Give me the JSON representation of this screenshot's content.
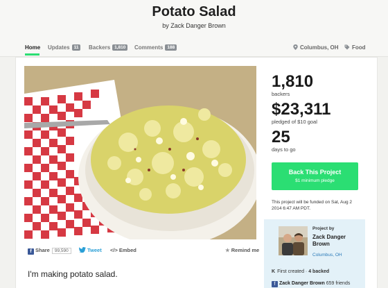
{
  "project": {
    "title": "Potato Salad",
    "byline": "by Zack Danger Brown",
    "description": "I'm making potato salad."
  },
  "nav": {
    "tabs": [
      {
        "label": "Home"
      },
      {
        "label": "Updates",
        "count": "11"
      },
      {
        "label": "Backers",
        "count": "1,810"
      },
      {
        "label": "Comments",
        "count": "188"
      }
    ],
    "location": "Columbus, OH",
    "category": "Food"
  },
  "share": {
    "facebook": "Share",
    "facebook_count": "99,590",
    "tweet": "Tweet",
    "embed": "Embed",
    "remind": "Remind me"
  },
  "stats": {
    "backers": "1,810",
    "backers_label": "backers",
    "pledged": "$23,311",
    "pledged_label": "pledged of $10 goal",
    "days": "25",
    "days_label": "days to go"
  },
  "cta": {
    "title": "Back This Project",
    "subtitle": "$1 minimum pledge"
  },
  "funding_note": "This project will be funded on Sat, Aug 2 2014 6:47 AM PDT.",
  "creator": {
    "label": "Project by",
    "name": "Zack Danger Brown",
    "location": "Columbus, OH",
    "created": "First created",
    "backed": "4 backed",
    "fb_name": "Zack Danger Brown",
    "fb_friends": "659 friends"
  },
  "colors": {
    "accent": "#2bde73",
    "facebook": "#3b5998",
    "link": "#2a7ab8",
    "creator_bg": "#e3f1f8"
  }
}
